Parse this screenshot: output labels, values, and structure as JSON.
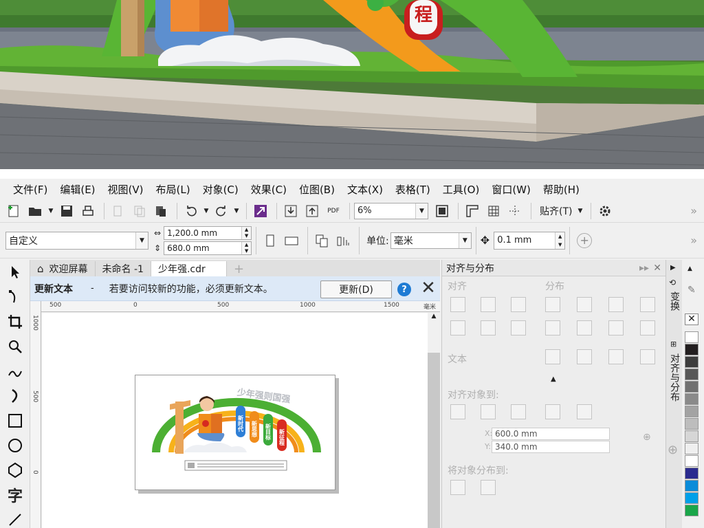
{
  "photo": {
    "sign_char": "程"
  },
  "menu": [
    {
      "label": "文件(F)"
    },
    {
      "label": "编辑(E)"
    },
    {
      "label": "视图(V)"
    },
    {
      "label": "布局(L)"
    },
    {
      "label": "对象(C)"
    },
    {
      "label": "效果(C)"
    },
    {
      "label": "位图(B)"
    },
    {
      "label": "文本(X)"
    },
    {
      "label": "表格(T)"
    },
    {
      "label": "工具(O)"
    },
    {
      "label": "窗口(W)"
    },
    {
      "label": "帮助(H)"
    }
  ],
  "toolbar": {
    "zoom_value": "6%",
    "snap_label": "贴齐(T)",
    "pdf_label": "PDF"
  },
  "propbar": {
    "preset_value": "自定义",
    "width_value": "1,200.0 mm",
    "height_value": "680.0 mm",
    "units_label": "单位:",
    "units_value": "毫米",
    "nudge_value": "0.1 mm"
  },
  "tabs": [
    {
      "label": "欢迎屏幕"
    },
    {
      "label": "未命名 -1"
    },
    {
      "label": "少年强.cdr"
    }
  ],
  "notify": {
    "title": "更新文本",
    "dash": "-",
    "message": "若要访问较新的功能，必须更新文本。",
    "button": "更新(D)",
    "help": "?"
  },
  "ruler": {
    "h_labels": [
      "500",
      "0",
      "500",
      "1000",
      "1500"
    ],
    "unit": "毫米",
    "v_labels": [
      "1000",
      "500",
      "0"
    ]
  },
  "design": {
    "arc_title": "少年强则国强",
    "pillars": [
      "新时代",
      "新思想",
      "新目标",
      "新征程"
    ]
  },
  "docker": {
    "title": "对齐与分布",
    "align_label": "对齐",
    "distribute_label": "分布",
    "text_label": "文本",
    "align_to_label": "对齐对象到:",
    "x_label": "X:",
    "x_value": "600.0 mm",
    "y_label": "Y:",
    "y_value": "340.0 mm",
    "distribute_to_label": "将对象分布到:"
  },
  "vtabs": {
    "transform": "变换",
    "align": "对齐与分布"
  },
  "palette": [
    "#ffffff",
    "#231f20",
    "#3d3d3d",
    "#575757",
    "#707070",
    "#8a8a8a",
    "#a3a3a3",
    "#bdbdbd",
    "#d6d6d6",
    "#efefef",
    "#ffffff",
    "#2b2b8f",
    "#0a8cd9",
    "#00a0e9",
    "#1aa64a"
  ]
}
